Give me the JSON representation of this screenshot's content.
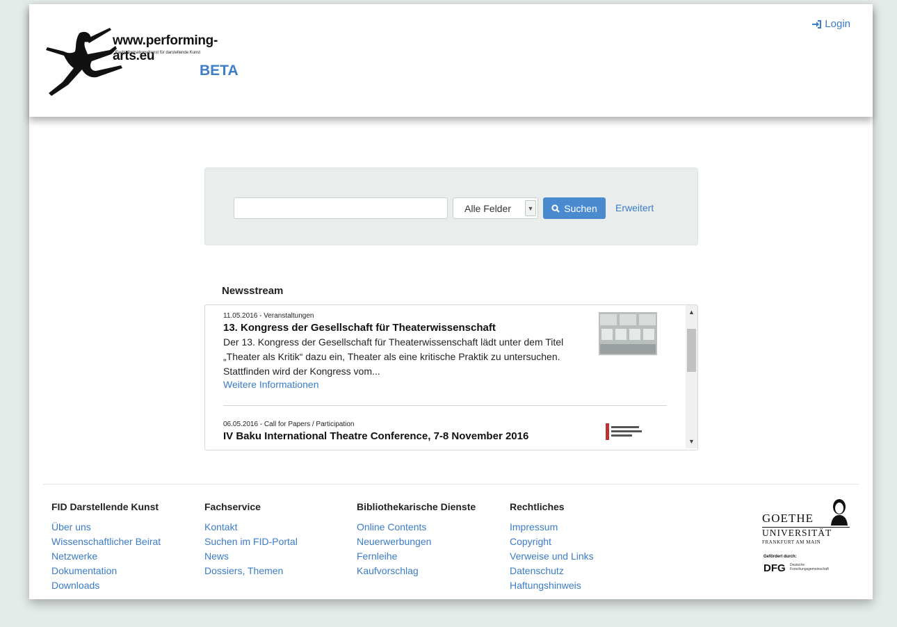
{
  "header": {
    "logo": {
      "url": "www.performing-arts.eu",
      "subtitle": "Fachinformationsdienst für darstellende Kunst",
      "badge": "BETA"
    },
    "login_label": "Login"
  },
  "search": {
    "input_value": "",
    "field_selected": "Alle Felder",
    "button_label": "Suchen",
    "advanced_label": "Erweitert"
  },
  "news": {
    "title": "Newsstream",
    "items": [
      {
        "meta": "11.05.2016 - Veranstaltungen",
        "headline": "13. Kongress der Gesellschaft für Theaterwissenschaft",
        "text": "Der 13. Kongress der Gesellschaft für Theaterwissenschaft lädt unter dem Titel „Theater als Kritik“ dazu ein, Theater als eine kritische Praktik zu untersuchen. Stattfinden wird der Kongress vom...",
        "link": "Weitere Informationen"
      },
      {
        "meta": "06.05.2016 - Call for Papers / Participation",
        "headline": "IV Baku International Theatre Conference, 7-8 November 2016"
      }
    ]
  },
  "footer": {
    "columns": [
      {
        "title": "FID Darstellende Kunst",
        "links": [
          "Über uns",
          "Wissenschaftlicher Beirat",
          "Netzwerke",
          "Dokumentation",
          "Downloads"
        ]
      },
      {
        "title": "Fachservice",
        "links": [
          "Kontakt",
          "Suchen im FID-Portal",
          "News",
          "Dossiers, Themen"
        ]
      },
      {
        "title": "Bibliothekarische Dienste",
        "links": [
          "Online Contents",
          "Neuerwerbungen",
          "Fernleihe",
          "Kaufvorschlag"
        ]
      },
      {
        "title": "Rechtliches",
        "links": [
          "Impressum",
          "Copyright",
          "Verweise und Links",
          "Datenschutz",
          "Haftungshinweis"
        ]
      }
    ],
    "goethe": {
      "name": "GOETHE",
      "university": "UNIVERSITÄT",
      "city": "FRANKFURT AM MAIN",
      "funded_by": "Gefördert durch:",
      "dfg": "DFG",
      "dfg_text": "Deutsche Forschungsgemeinschaft"
    }
  },
  "colors": {
    "accent": "#4a8bd0",
    "link": "#3a7bc8",
    "background": "#e4ebe9"
  }
}
